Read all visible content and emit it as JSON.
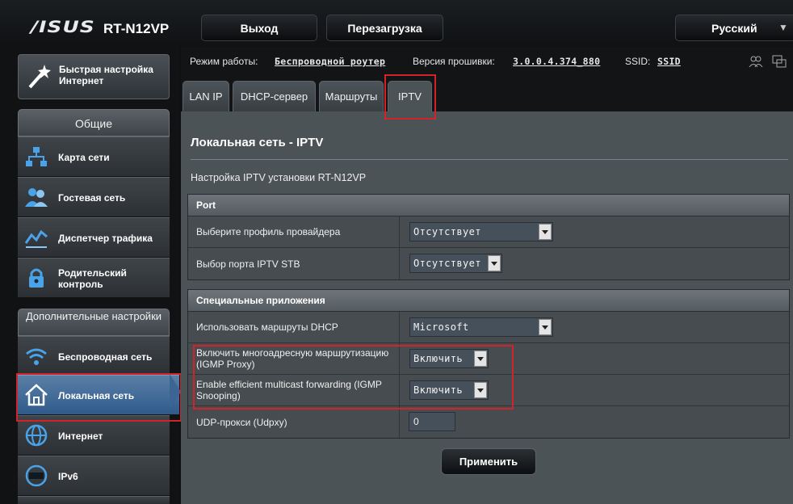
{
  "header": {
    "logo": "/ISUS",
    "model": "RT-N12VP",
    "logout_label": "Выход",
    "reboot_label": "Перезагрузка",
    "language": "Русский"
  },
  "sidebar": {
    "quick_setup": "Быстрая настройка Интернет",
    "general_title": "Общие",
    "general_items": [
      {
        "label": "Карта сети",
        "icon": "network-map-icon"
      },
      {
        "label": "Гостевая сеть",
        "icon": "guest-network-icon"
      },
      {
        "label": "Диспетчер трафика",
        "icon": "traffic-manager-icon"
      },
      {
        "label": "Родительский контроль",
        "icon": "parental-lock-icon"
      }
    ],
    "advanced_title": "Дополнительные настройки",
    "advanced_items": [
      {
        "label": "Беспроводная сеть",
        "icon": "wifi-icon"
      },
      {
        "label": "Локальная сеть",
        "icon": "home-icon",
        "active": true
      },
      {
        "label": "Интернет",
        "icon": "globe-icon"
      },
      {
        "label": "IPv6",
        "icon": "ipv6-icon"
      }
    ]
  },
  "infobar": {
    "mode_label": "Режим работы:",
    "mode_value": "Беспроводной роутер",
    "fw_label": "Версия прошивки:",
    "fw_value": "3.0.0.4.374_880",
    "ssid_label": "SSID:",
    "ssid_value": "SSID"
  },
  "tabs": [
    "LAN IP",
    "DHCP-сервер",
    "Маршруты",
    "IPTV"
  ],
  "active_tab": "IPTV",
  "page": {
    "title": "Локальная сеть - IPTV",
    "description": "Настройка IPTV установки RT-N12VP"
  },
  "port_section": {
    "title": "Port",
    "rows": [
      {
        "label": "Выберите профиль провайдера",
        "value": "Отсутствует"
      },
      {
        "label": "Выбор порта IPTV STB",
        "value": "Отсутствует"
      }
    ]
  },
  "apps_section": {
    "title": "Специальные приложения",
    "rows": [
      {
        "label": "Использовать маршруты DHCP",
        "value": "Microsoft"
      },
      {
        "label": "Включить многоадресную маршрутизацию (IGMP Proxy)",
        "value": "Включить"
      },
      {
        "label": "Enable efficient multicast forwarding (IGMP Snooping)",
        "value": "Включить"
      },
      {
        "label": "UDP-прокси (Udpxy)",
        "value": "0"
      }
    ]
  },
  "apply_label": "Применить",
  "colors": {
    "highlight": "#d3232a",
    "active_nav": "#2f5b8b"
  }
}
